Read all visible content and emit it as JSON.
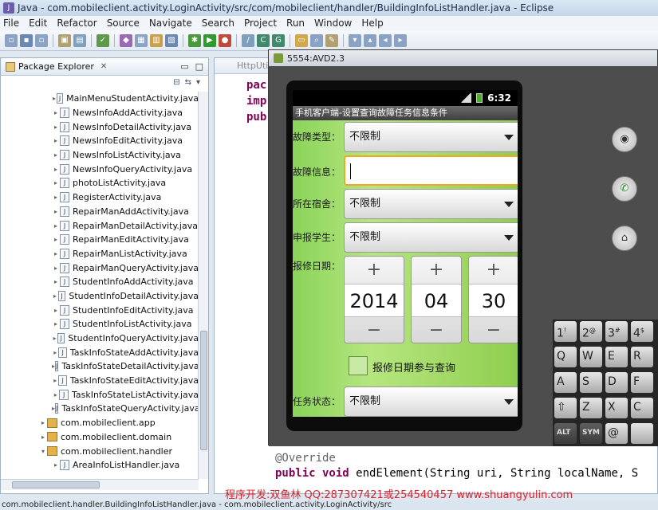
{
  "window": {
    "title": "Java - com.mobileclient.activity.LoginActivity/src/com/mobileclient/handler/BuildingInfoListHandler.java - Eclipse"
  },
  "menubar": {
    "items": [
      "File",
      "Edit",
      "Refactor",
      "Source",
      "Navigate",
      "Search",
      "Project",
      "Run",
      "Window",
      "Help"
    ]
  },
  "package_explorer": {
    "title": "Package Explorer",
    "files": [
      "MainMenuStudentActivity.java",
      "NewsInfoAddActivity.java",
      "NewsInfoDetailActivity.java",
      "NewsInfoEditActivity.java",
      "NewsInfoListActivity.java",
      "NewsInfoQueryActivity.java",
      "photoListActivity.java",
      "RegisterActivity.java",
      "RepairManAddActivity.java",
      "RepairManDetailActivity.java",
      "RepairManEditActivity.java",
      "RepairManListActivity.java",
      "RepairManQueryActivity.java",
      "StudentInfoAddActivity.java",
      "StudentInfoDetailActivity.java",
      "StudentInfoEditActivity.java",
      "StudentInfoListActivity.java",
      "StudentInfoQueryActivity.java",
      "TaskInfoStateAddActivity.java",
      "TaskInfoStateDetailActivity.java",
      "TaskInfoStateEditActivity.java",
      "TaskInfoStateListActivity.java",
      "TaskInfoStateQueryActivity.java"
    ],
    "packages": [
      "com.mobileclient.app",
      "com.mobileclient.domain",
      "com.mobileclient.handler"
    ],
    "last_file": "AreaInfoListHandler.java"
  },
  "editor": {
    "tab_label": "HttpUtil",
    "code_lines": [
      "pac",
      "imp",
      "pub"
    ],
    "annotation": "@Override",
    "method_keywords": "public void",
    "method_rest": "endElement(String uri, String localName, S"
  },
  "emulator": {
    "title": "5554:AVD2.3",
    "clock": "6:32",
    "app_title": "手机客户端-设置查询故障任务信息条件",
    "fields": {
      "fault_type_label": "故障类型：",
      "fault_type_value": "不限制",
      "fault_info_label": "故障信息：",
      "dorm_label": "所在宿舍：",
      "dorm_value": "不限制",
      "student_label": "申报学生：",
      "student_value": "不限制",
      "date_label": "报修日期：",
      "year": "2014",
      "month": "04",
      "day": "30",
      "checkbox_label": "报修日期参与查询",
      "task_state_label": "任务状态：",
      "task_state_value": "不限制"
    },
    "keyboard": {
      "rows": [
        [
          "1",
          "2",
          "3",
          "4"
        ],
        [
          "Q",
          "W",
          "E",
          "R"
        ],
        [
          "A",
          "S",
          "D",
          "F"
        ],
        [
          "⇧",
          "Z",
          "X",
          "C"
        ],
        [
          "ALT",
          "SYM",
          "@",
          ""
        ]
      ],
      "symbols": [
        "!",
        "@",
        "#",
        "$"
      ]
    }
  },
  "watermark": "程序开发:双鱼林 QQ:287307421或254540457 www.shuangyulin.com",
  "statusbar": "com.mobileclient.handler.BuildingInfoListHandler.java - com.mobileclient.activity.LoginActivity/src",
  "colors": {
    "accent": "#f5a623",
    "screen_green": "#8ad35a",
    "watermark_red": "#d8232a"
  }
}
